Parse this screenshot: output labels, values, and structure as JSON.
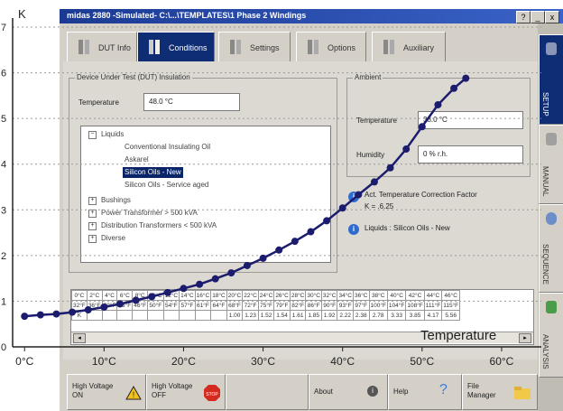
{
  "window": {
    "title": "midas 2880 -Simulated- C:\\...\\TEMPLATES\\1  Phase 2 Windings",
    "help_btn": "?",
    "min_btn": "_",
    "close_btn": "x"
  },
  "tabs": [
    {
      "label": "DUT Info",
      "active": false
    },
    {
      "label": "Conditions",
      "active": true
    },
    {
      "label": "Settings",
      "active": false
    },
    {
      "label": "Options",
      "active": false
    },
    {
      "label": "Auxiliary",
      "active": false
    }
  ],
  "dut_group": {
    "title": "Device Under Test (DUT) Insulation",
    "temperature_label": "Temperature",
    "temperature_value": "48.0 °C",
    "tree": [
      {
        "label": "Liquids",
        "level": 0,
        "expanded": true
      },
      {
        "label": "Conventional Insulating Oil",
        "level": 1
      },
      {
        "label": "Askarel",
        "level": 1
      },
      {
        "label": "Silicon Oils - New",
        "level": 1,
        "selected": true
      },
      {
        "label": "Silicon Oils - Service aged",
        "level": 1
      },
      {
        "label": "Bushings",
        "level": 0,
        "expanded": false
      },
      {
        "label": "Power Transformer > 500 kVA",
        "level": 0,
        "expanded": false
      },
      {
        "label": "Distribution Transformers < 500 kVA",
        "level": 0,
        "expanded": false
      },
      {
        "label": "Diverse",
        "level": 0,
        "expanded": false
      }
    ]
  },
  "ambient_group": {
    "title": "Ambient",
    "temperature_label": "Temperature",
    "temperature_value": "33.0 °C",
    "humidity_label": "Humidity",
    "humidity_value": "0 % r.h."
  },
  "info_lines": [
    {
      "label": "Act. Temperature Correction Factor",
      "value": "K = .6.25"
    },
    {
      "label": "Liquids : Silicon Oils - New",
      "value": ""
    }
  ],
  "correction_table": {
    "celsius": [
      "0°C",
      "2°C",
      "4°C",
      "6°C",
      "8°C",
      "10°C",
      "12°C",
      "14°C",
      "16°C",
      "18°C",
      "20°C",
      "22°C",
      "24°C",
      "26°C",
      "28°C",
      "30°C",
      "32°C",
      "34°C",
      "36°C",
      "38°C",
      "40°C",
      "42°C",
      "44°C",
      "46°C"
    ],
    "fahrenheit": [
      "32°F",
      "36°F",
      "39°F",
      "43°F",
      "46°F",
      "50°F",
      "54°F",
      "57°F",
      "61°F",
      "64°F",
      "68°F",
      "72°F",
      "75°F",
      "79°F",
      "82°F",
      "86°F",
      "90°F",
      "93°F",
      "97°F",
      "100°F",
      "104°F",
      "108°F",
      "111°F",
      "115°F"
    ],
    "k_label": "K",
    "k_values": [
      "",
      "",
      "",
      "",
      "",
      "",
      "",
      "",
      "",
      "",
      "1.00",
      "1.23",
      "1.52",
      "1.54",
      "1.61",
      "1.85",
      "1.92",
      "2.22",
      "2.38",
      "2.78",
      "3.33",
      "3.85",
      "4.17",
      "5.56"
    ]
  },
  "right_tabs": [
    {
      "label": "SETUP",
      "active": true
    },
    {
      "label": "MANUAL",
      "active": false
    },
    {
      "label": "SEQUENCE",
      "active": false
    },
    {
      "label": "ANALYSIS",
      "active": false
    }
  ],
  "bottom_buttons": [
    {
      "line1": "High Voltage",
      "line2": "ON",
      "icon": "warning-icon"
    },
    {
      "line1": "High Voltage",
      "line2": "OFF",
      "icon": "stop-icon"
    },
    {
      "line1": "",
      "line2": "",
      "icon": ""
    },
    {
      "line1": "About",
      "line2": "",
      "icon": "info-icon"
    },
    {
      "line1": "Help",
      "line2": "",
      "icon": "help-icon"
    },
    {
      "line1": "File",
      "line2": "Manager",
      "icon": "folder-icon"
    }
  ],
  "chart_data": {
    "type": "line",
    "ylabel": "K",
    "xlabel": "Temperature",
    "x_ticks": [
      "0°C",
      "10°C",
      "20°C",
      "30°C",
      "40°C",
      "50°C",
      "60°C"
    ],
    "y_ticks": [
      "0",
      "1",
      "2",
      "3",
      "4",
      "5",
      "6",
      "7"
    ],
    "xlim": [
      -1.5,
      65
    ],
    "ylim": [
      0,
      7
    ],
    "grid": true,
    "series": [
      {
        "color": "#1c1c6e",
        "x": [
          0,
          2,
          4,
          6,
          8,
          10,
          12,
          14,
          16,
          18,
          20,
          22,
          24,
          26,
          28,
          30,
          32,
          34,
          36,
          38,
          40,
          42,
          44,
          46,
          48,
          50,
          52,
          54,
          55.5
        ],
        "y": [
          0.67,
          0.7,
          0.72,
          0.76,
          0.81,
          0.87,
          0.94,
          1.02,
          1.1,
          1.19,
          1.28,
          1.37,
          1.49,
          1.62,
          1.78,
          1.94,
          2.12,
          2.31,
          2.52,
          2.76,
          3.04,
          3.33,
          3.61,
          3.92,
          4.33,
          4.82,
          5.3,
          5.66,
          5.88
        ]
      }
    ]
  }
}
